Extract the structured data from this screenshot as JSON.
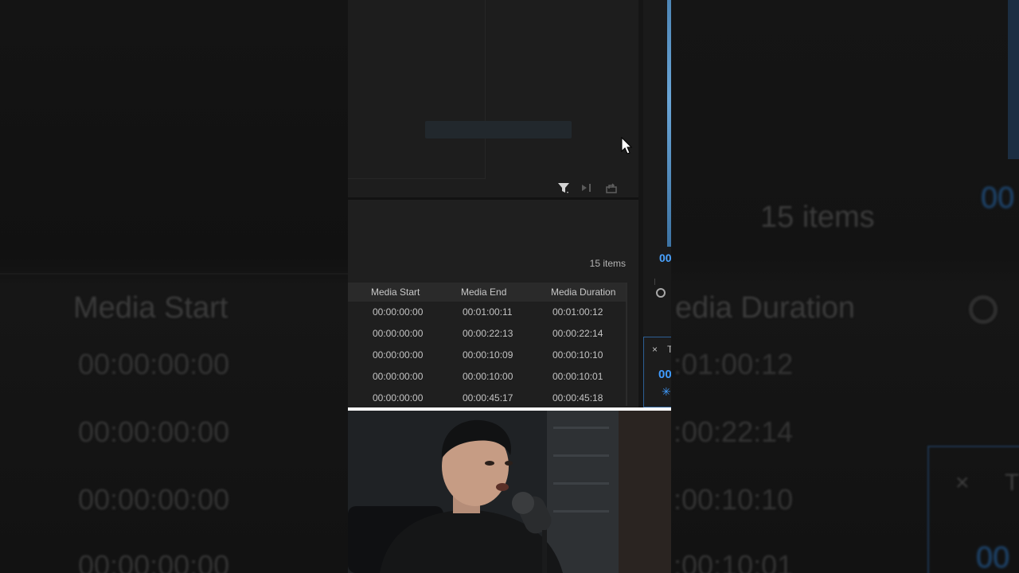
{
  "background": {
    "items_count": "15 items",
    "column_start": "Media Start",
    "column_duration": "edia Duration",
    "timecodes_left": [
      "00:00:00:00",
      "00:00:00:00",
      "00:00:00:00",
      "00:00:00:00"
    ],
    "timecodes_right": [
      ":01:00:12",
      ":00:22:14",
      ":00:10:10",
      ":00:10:01"
    ],
    "blue_tc_top": "00",
    "blue_tc_bottom": "00",
    "close_x": "×",
    "right_t": "T"
  },
  "project_panel": {
    "items_count": "15 items",
    "columns": [
      "Media Start",
      "Media End",
      "Media Duration"
    ],
    "rows": [
      {
        "start": "00:00:00:00",
        "end": "00:01:00:11",
        "duration": "00:01:00:12"
      },
      {
        "start": "00:00:00:00",
        "end": "00:00:22:13",
        "duration": "00:00:22:14"
      },
      {
        "start": "00:00:00:00",
        "end": "00:00:10:09",
        "duration": "00:00:10:10"
      },
      {
        "start": "00:00:00:00",
        "end": "00:00:10:00",
        "duration": "00:00:10:01"
      },
      {
        "start": "00:00:00:00",
        "end": "00:00:45:17",
        "duration": "00:00:45:18"
      }
    ],
    "toolbar_icons": [
      "filter-icon",
      "insert-icon",
      "export-icon"
    ]
  },
  "right_strip": {
    "timecode": "00",
    "mini_close": "×",
    "mini_title": "T",
    "mini_timecode": "00",
    "mini_spark": "✳"
  },
  "colors": {
    "accent_blue": "#4aa3ff",
    "panel_border_blue": "#2d5f95"
  }
}
